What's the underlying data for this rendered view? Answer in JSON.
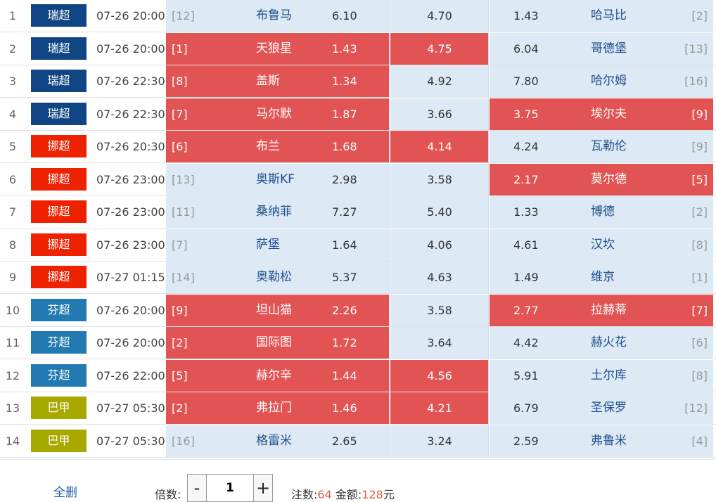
{
  "colors": {
    "league_ruichao": "#0f4583",
    "league_nuochao": "#ee2200",
    "league_fenchao": "#227ab0",
    "league_bajia": "#a7a800",
    "cell_plain": "#dde9f4",
    "cell_selected": "#e25454"
  },
  "matches": [
    {
      "idx": "1",
      "league": "瑞超",
      "league_color": "#0f4583",
      "time": "07-26 20:00",
      "home_rank": "[12]",
      "home": "布鲁马",
      "home_odd": "6.10",
      "draw_odd": "4.70",
      "away_odd": "1.43",
      "away": "哈马比",
      "away_rank": "[2]",
      "sel_home": false,
      "sel_draw": false,
      "sel_away": false
    },
    {
      "idx": "2",
      "league": "瑞超",
      "league_color": "#0f4583",
      "time": "07-26 20:00",
      "home_rank": "[1]",
      "home": "天狼星",
      "home_odd": "1.43",
      "draw_odd": "4.75",
      "away_odd": "6.04",
      "away": "哥德堡",
      "away_rank": "[13]",
      "sel_home": true,
      "sel_draw": true,
      "sel_away": false
    },
    {
      "idx": "3",
      "league": "瑞超",
      "league_color": "#0f4583",
      "time": "07-26 22:30",
      "home_rank": "[8]",
      "home": "盖斯",
      "home_odd": "1.34",
      "draw_odd": "4.92",
      "away_odd": "7.80",
      "away": "哈尔姆",
      "away_rank": "[16]",
      "sel_home": true,
      "sel_draw": false,
      "sel_away": false
    },
    {
      "idx": "4",
      "league": "瑞超",
      "league_color": "#0f4583",
      "time": "07-26 22:30",
      "home_rank": "[7]",
      "home": "马尔默",
      "home_odd": "1.87",
      "draw_odd": "3.66",
      "away_odd": "3.75",
      "away": "埃尔夫",
      "away_rank": "[9]",
      "sel_home": true,
      "sel_draw": false,
      "sel_away": true
    },
    {
      "idx": "5",
      "league": "挪超",
      "league_color": "#ee2200",
      "time": "07-26 20:30",
      "home_rank": "[6]",
      "home": "布兰",
      "home_odd": "1.68",
      "draw_odd": "4.14",
      "away_odd": "4.24",
      "away": "瓦勒伦",
      "away_rank": "[9]",
      "sel_home": true,
      "sel_draw": true,
      "sel_away": false
    },
    {
      "idx": "6",
      "league": "挪超",
      "league_color": "#ee2200",
      "time": "07-26 23:00",
      "home_rank": "[13]",
      "home": "奥斯KF",
      "home_odd": "2.98",
      "draw_odd": "3.58",
      "away_odd": "2.17",
      "away": "莫尔德",
      "away_rank": "[5]",
      "sel_home": false,
      "sel_draw": false,
      "sel_away": true
    },
    {
      "idx": "7",
      "league": "挪超",
      "league_color": "#ee2200",
      "time": "07-26 23:00",
      "home_rank": "[11]",
      "home": "桑纳菲",
      "home_odd": "7.27",
      "draw_odd": "5.40",
      "away_odd": "1.33",
      "away": "博德",
      "away_rank": "[2]",
      "sel_home": false,
      "sel_draw": false,
      "sel_away": false
    },
    {
      "idx": "8",
      "league": "挪超",
      "league_color": "#ee2200",
      "time": "07-26 23:00",
      "home_rank": "[7]",
      "home": "萨堡",
      "home_odd": "1.64",
      "draw_odd": "4.06",
      "away_odd": "4.61",
      "away": "汉坎",
      "away_rank": "[8]",
      "sel_home": false,
      "sel_draw": false,
      "sel_away": false
    },
    {
      "idx": "9",
      "league": "挪超",
      "league_color": "#ee2200",
      "time": "07-27 01:15",
      "home_rank": "[14]",
      "home": "奥勒松",
      "home_odd": "5.37",
      "draw_odd": "4.63",
      "away_odd": "1.49",
      "away": "维京",
      "away_rank": "[1]",
      "sel_home": false,
      "sel_draw": false,
      "sel_away": false
    },
    {
      "idx": "10",
      "league": "芬超",
      "league_color": "#227ab0",
      "time": "07-26 20:00",
      "home_rank": "[9]",
      "home": "坦山猫",
      "home_odd": "2.26",
      "draw_odd": "3.58",
      "away_odd": "2.77",
      "away": "拉赫蒂",
      "away_rank": "[7]",
      "sel_home": true,
      "sel_draw": false,
      "sel_away": true
    },
    {
      "idx": "11",
      "league": "芬超",
      "league_color": "#227ab0",
      "time": "07-26 20:00",
      "home_rank": "[2]",
      "home": "国际图",
      "home_odd": "1.72",
      "draw_odd": "3.64",
      "away_odd": "4.42",
      "away": "赫火花",
      "away_rank": "[6]",
      "sel_home": true,
      "sel_draw": false,
      "sel_away": false
    },
    {
      "idx": "12",
      "league": "芬超",
      "league_color": "#227ab0",
      "time": "07-26 22:00",
      "home_rank": "[5]",
      "home": "赫尔辛",
      "home_odd": "1.44",
      "draw_odd": "4.56",
      "away_odd": "5.91",
      "away": "土尔库",
      "away_rank": "[8]",
      "sel_home": true,
      "sel_draw": true,
      "sel_away": false
    },
    {
      "idx": "13",
      "league": "巴甲",
      "league_color": "#a7a800",
      "time": "07-27 05:30",
      "home_rank": "[2]",
      "home": "弗拉门",
      "home_odd": "1.46",
      "draw_odd": "4.21",
      "away_odd": "6.79",
      "away": "圣保罗",
      "away_rank": "[12]",
      "sel_home": true,
      "sel_draw": true,
      "sel_away": false
    },
    {
      "idx": "14",
      "league": "巴甲",
      "league_color": "#a7a800",
      "time": "07-27 05:30",
      "home_rank": "[16]",
      "home": "格雷米",
      "home_odd": "2.65",
      "draw_odd": "3.24",
      "away_odd": "2.59",
      "away": "弗鲁米",
      "away_rank": "[4]",
      "sel_home": false,
      "sel_draw": false,
      "sel_away": false
    }
  ],
  "footer": {
    "clear_label": "全删",
    "multiplier_label": "倍数:",
    "minus": "-",
    "plus": "+",
    "multiplier_value": "1",
    "count_label": "注数:",
    "count_value": "64",
    "amount_label": "金额:",
    "amount_value": "128",
    "amount_unit": "元"
  }
}
